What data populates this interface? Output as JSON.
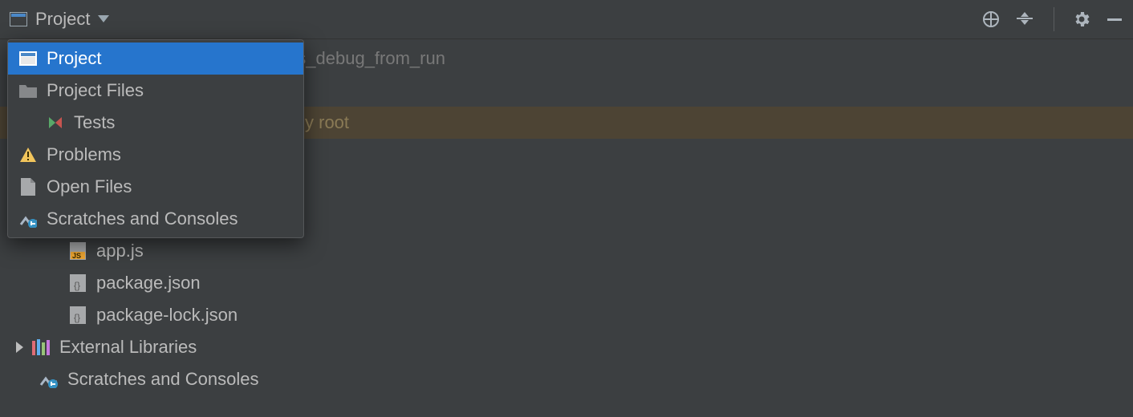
{
  "toolbar": {
    "selector_label": "Project"
  },
  "dropdown": {
    "items": [
      {
        "label": "Project"
      },
      {
        "label": "Project Files"
      },
      {
        "label": "Tests"
      },
      {
        "label": "Problems"
      },
      {
        "label": "Open Files"
      },
      {
        "label": "Scratches and Consoles"
      }
    ]
  },
  "tree": {
    "root_name": "from_run",
    "root_path": "~/WS/node_express_debug_from_run",
    "highlighted_suffix": "y root",
    "files": {
      "app": "app.js",
      "pkg": "package.json",
      "lock": "package-lock.json"
    },
    "external_libs": "External Libraries",
    "scratches": "Scratches and Consoles"
  }
}
